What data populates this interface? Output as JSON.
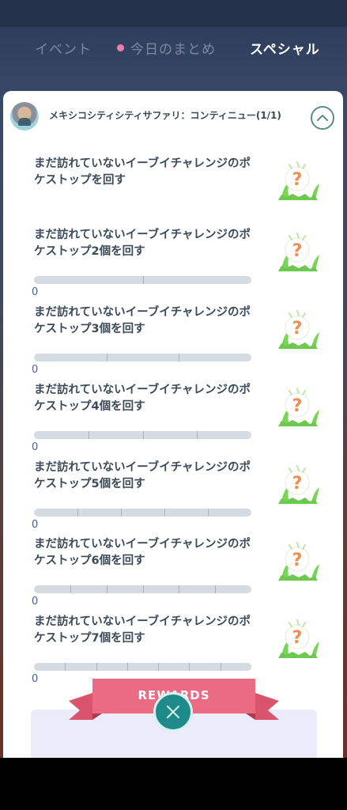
{
  "tabs": {
    "events": "イベント",
    "today": "今日のまとめ",
    "special": "スペシャル"
  },
  "header": {
    "title": "メキシコシティシティサファリ：コンティニュー(1/1)"
  },
  "tasks": [
    {
      "text": "まだ訪れていないイーブイチャレンジのポケストップを回す",
      "count": "",
      "segments": 0
    },
    {
      "text": "まだ訪れていないイーブイチャレンジのポケストップ2個を回す",
      "count": "0",
      "segments": 2,
      "progress": 0
    },
    {
      "text": "まだ訪れていないイーブイチャレンジのポケストップ3個を回す",
      "count": "0",
      "segments": 3,
      "progress": 0
    },
    {
      "text": "まだ訪れていないイーブイチャレンジのポケストップ4個を回す",
      "count": "0",
      "segments": 4,
      "progress": 0
    },
    {
      "text": "まだ訪れていないイーブイチャレンジのポケストップ5個を回す",
      "count": "0",
      "segments": 5,
      "progress": 0
    },
    {
      "text": "まだ訪れていないイーブイチャレンジのポケストップ6個を回す",
      "count": "0",
      "segments": 6,
      "progress": 0
    },
    {
      "text": "まだ訪れていないイーブイチャレンジのポケストップ7個を回す",
      "count": "0",
      "segments": 7,
      "progress": 0
    }
  ],
  "rewards": {
    "label": "REWARDS"
  },
  "icons": {
    "collapse": "chevron-up-icon",
    "reward": "mystery-reward-icon",
    "close": "close-icon"
  },
  "colors": {
    "accent": "#1e8a8a",
    "ribbon": "#e8607a",
    "count": "#4d5aa8"
  }
}
